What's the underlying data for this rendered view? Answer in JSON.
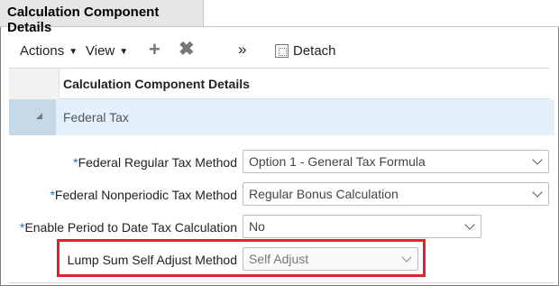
{
  "tab": {
    "title": "Calculation Component Details"
  },
  "toolbar": {
    "actions_label": "Actions",
    "view_label": "View",
    "add_icon": "plus-icon",
    "delete_icon": "x-icon",
    "overflow_label": "»",
    "detach_label": "Detach"
  },
  "grid": {
    "header_label": "Calculation Component Details",
    "group_label": "Federal Tax"
  },
  "fields": {
    "regular_tax_method": {
      "label": "Federal Regular Tax Method",
      "required_mark": "*",
      "value": "Option 1 - General Tax Formula"
    },
    "nonperiodic_tax_method": {
      "label": "Federal Nonperiodic Tax Method",
      "required_mark": "*",
      "value": "Regular Bonus Calculation"
    },
    "period_to_date": {
      "label": "Enable Period to Date Tax Calculation",
      "required_mark": "*",
      "value": "No"
    },
    "lump_sum": {
      "label": "Lump Sum Self Adjust Method",
      "value": "Self Adjust"
    }
  },
  "colors": {
    "highlight": "#d9242b",
    "required": "#1a73c8",
    "selected_row": "#e4f1fb"
  }
}
